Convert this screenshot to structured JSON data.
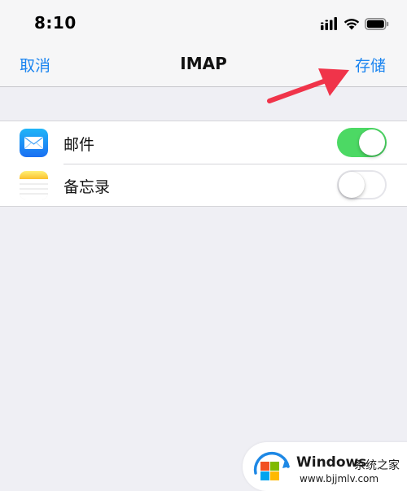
{
  "status_bar": {
    "time": "8:10"
  },
  "nav": {
    "cancel_label": "取消",
    "title": "IMAP",
    "save_label": "存储"
  },
  "list": {
    "items": [
      {
        "label": "邮件",
        "icon": "mail-app-icon",
        "enabled": true
      },
      {
        "label": "备忘录",
        "icon": "notes-app-icon",
        "enabled": false
      }
    ]
  },
  "watermark": {
    "name": "Windows",
    "subtitle": "系统之家",
    "url": "www.bjjmlv.com"
  },
  "colors": {
    "accent": "#1a84f0",
    "toggle_on": "#4cd964",
    "arrow": "#f0344a",
    "background": "#efeff4"
  }
}
